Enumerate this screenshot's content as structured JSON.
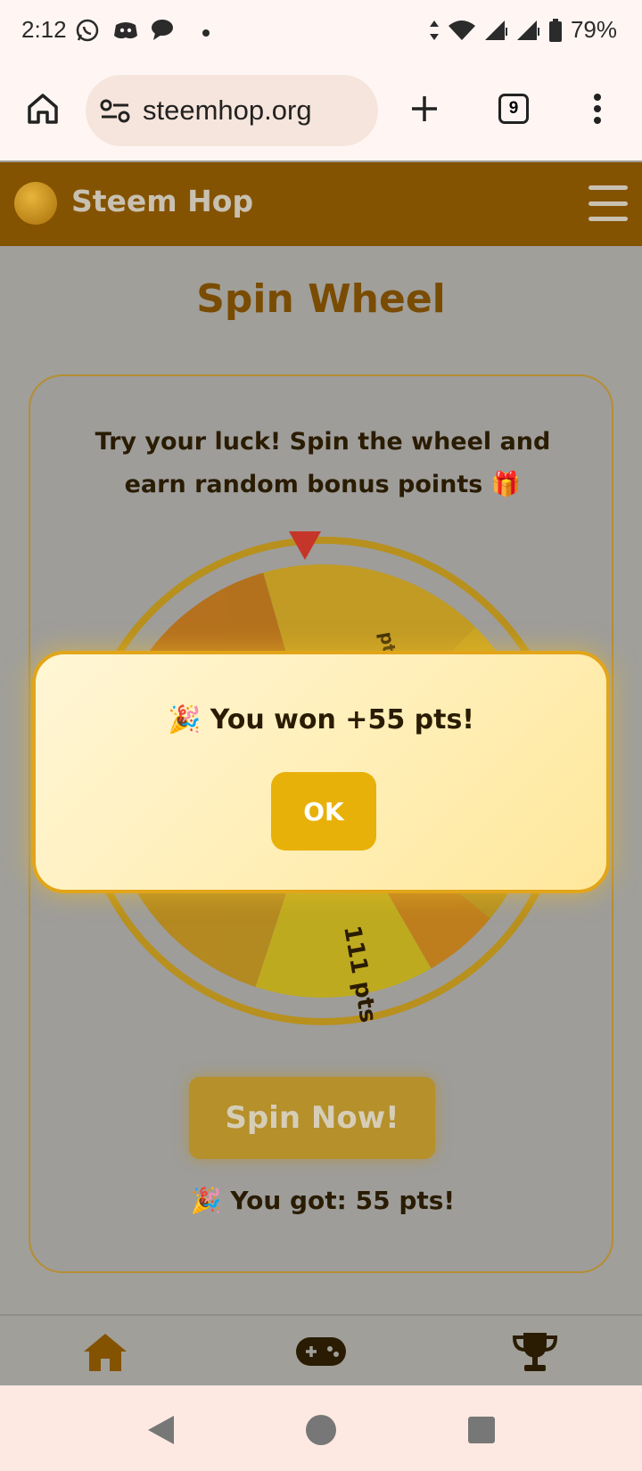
{
  "status_bar": {
    "time": "2:12",
    "battery": "79%",
    "icons": [
      "whatsapp-icon",
      "discord-icon",
      "chat-icon",
      "dot-icon",
      "data-arrows-icon",
      "wifi-icon",
      "signal-icon",
      "signal-icon",
      "battery-icon"
    ]
  },
  "browser": {
    "url": "steemhop.org",
    "tab_count": "9",
    "icons": [
      "home-icon",
      "site-settings-icon",
      "new-tab-icon",
      "tabs-icon",
      "more-icon"
    ]
  },
  "header": {
    "brand": "Steem Hop",
    "logo_text": "STEEM HOP",
    "accent_color": "#845301"
  },
  "main": {
    "title": "Spin Wheel",
    "intro": "Try your luck! Spin the wheel and earn random bonus points 🎁",
    "spin_button": "Spin Now!",
    "result": "🎉 You got: 55 pts!",
    "wheel_labels": [
      "pts",
      "111 pts"
    ]
  },
  "modal": {
    "message": "🎉 You won +55 pts!",
    "ok_label": "OK",
    "accent_color": "#e8b10a"
  },
  "bottom_nav": {
    "items": [
      "home-icon",
      "gamepad-icon",
      "trophy-icon"
    ]
  },
  "system_nav": {
    "items": [
      "back-icon",
      "home-circle-icon",
      "recents-icon"
    ]
  }
}
